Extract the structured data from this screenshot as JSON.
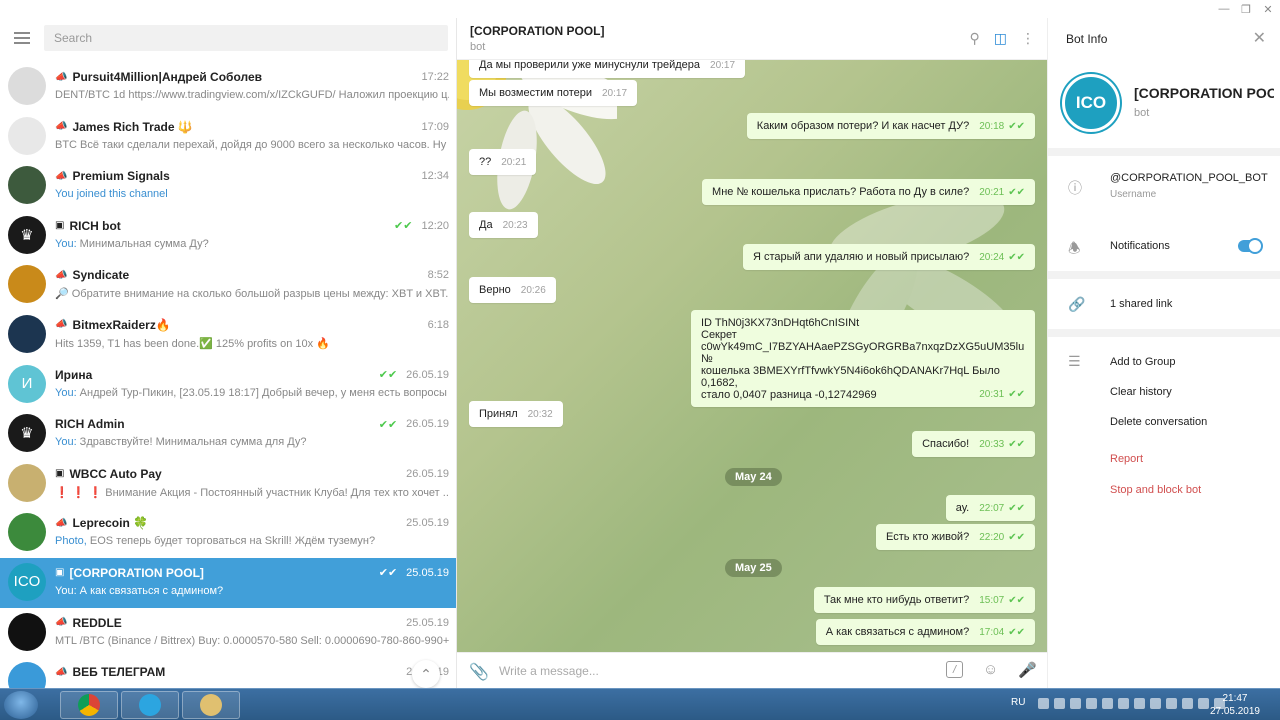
{
  "search": {
    "placeholder": "Search"
  },
  "chats": [
    {
      "name": "Pursuit4Million|Андрей Соболев",
      "type_icon": "megaphone-icon",
      "time": "17:22",
      "preview": "DENT/BTC 1d https://www.tradingview.com/x/IZCkGUFD/  Наложил проекцию ц...",
      "avatar_color": "#dcdcdc",
      "avatar_text": ""
    },
    {
      "name": "James Rich Trade 🔱",
      "type_icon": "megaphone-icon",
      "time": "17:09",
      "preview": "BTC Всё таки сделали перехай, дойдя до 9000 всего за несколько часов.  Ну и с...",
      "avatar_color": "#e8e8e8",
      "avatar_text": ""
    },
    {
      "name": "Premium Signals",
      "type_icon": "megaphone-icon",
      "time": "12:34",
      "you": "You joined this channel",
      "preview": "",
      "avatar_color": "#3d5a3d",
      "avatar_text": ""
    },
    {
      "name": "RICH bot",
      "type_icon": "bot-icon",
      "time": "12:20",
      "ticks": true,
      "you": "You:",
      "preview": " Минимальная сумма Ду?",
      "avatar_color": "#1a1a1a",
      "avatar_text": "♛"
    },
    {
      "name": "Syndicate",
      "type_icon": "megaphone-icon",
      "time": "8:52",
      "preview": "🔎 Обратите внимание на сколько большой разрыв цены между:  XBT и XBT...",
      "avatar_color": "#c98a1a",
      "avatar_text": ""
    },
    {
      "name": "BitmexRaiderz🔥",
      "type_icon": "megaphone-icon",
      "time": "6:18",
      "preview": "Hits 1359, T1 has been done.✅  125% profits on 10x 🔥",
      "avatar_color": "#1c3550",
      "avatar_text": ""
    },
    {
      "name": "Ирина",
      "type_icon": "",
      "time": "26.05.19",
      "ticks": true,
      "you": "You:",
      "preview": " Андрей Тур-Пикин, [23.05.19 18:17] Добрый вечер, у меня есть вопросы п...",
      "avatar_color": "#5fc4d4",
      "avatar_text": "И"
    },
    {
      "name": "RICH Admin",
      "type_icon": "",
      "time": "26.05.19",
      "ticks": true,
      "you": "You:",
      "preview": " Здравствуйте! Минимальная сумма для Ду?",
      "avatar_color": "#1a1a1a",
      "avatar_text": "♛"
    },
    {
      "name": "WBCC Auto Pay",
      "type_icon": "bot-icon",
      "time": "26.05.19",
      "preview": "❗ ❗ ❗  Внимание Акция - Постоянный участник Клуба!   Для тех кто хочет ...",
      "avatar_color": "#c8b070",
      "avatar_text": ""
    },
    {
      "name": "Leprecoin 🍀",
      "type_icon": "megaphone-icon",
      "time": "25.05.19",
      "you": "Photo,",
      "preview": " EOS теперь будет торговаться на Skrill! Ждём туземун?",
      "avatar_color": "#3c8a3c",
      "avatar_text": ""
    },
    {
      "name": "[CORPORATION POOL]",
      "type_icon": "bot-icon",
      "time": "25.05.19",
      "ticks": true,
      "you": "You:",
      "preview": " А как связаться с админом?",
      "avatar_color": "#1ea0c0",
      "avatar_text": "ICO",
      "active": true
    },
    {
      "name": "REDDLE",
      "type_icon": "megaphone-icon",
      "time": "25.05.19",
      "preview": "MTL /BTC (Binance / Bittrex)  Buy: 0.0000570-580  Sell: 0.0000690-780-860-990+",
      "avatar_color": "#111111",
      "avatar_text": ""
    },
    {
      "name": "ВЕБ ТЕЛЕГРАМ",
      "type_icon": "megaphone-icon",
      "time": "24.05.19",
      "preview": "",
      "avatar_color": "#3a9ad9",
      "avatar_text": ""
    }
  ],
  "header": {
    "title": "[CORPORATION POOL]",
    "subtitle": "bot"
  },
  "messages": [
    {
      "text": "Да мы проверили уже минуснули трейдера",
      "time": "20:17",
      "out": false
    },
    {
      "text": "Мы возместим потери",
      "time": "20:17",
      "out": false
    },
    {
      "text": "Каким образом потери? И как насчет ДУ?",
      "time": "20:18",
      "out": true
    },
    {
      "text": "??",
      "time": "20:21",
      "out": false
    },
    {
      "text": "Мне № кошелька прислать? Работа по Ду в силе?",
      "time": "20:21",
      "out": true
    },
    {
      "text": "Да",
      "time": "20:23",
      "out": false
    },
    {
      "text": "Я старый апи удаляю и новый присылаю?",
      "time": "20:24",
      "out": true
    },
    {
      "text": "Верно",
      "time": "20:26",
      "out": false
    },
    {
      "text": "ID  ThN0j3KX73nDHqt6hCnISINt\nСекрет\nc0wYk49mC_I7BZYAHAaePZSGyORGRBa7nxqzDzXG5uUM35lu  №\nкошелька 3BMEXYrfTfvwkY5N4i6ok6hQDANAKr7HqL  Было 0,1682,\nстало 0,0407 разница  -0,12742969",
      "time": "20:31",
      "out": true
    },
    {
      "text": "Принял",
      "time": "20:32",
      "out": false
    },
    {
      "text": "Спасибо!",
      "time": "20:33",
      "out": true
    },
    {
      "text": "ау.",
      "time": "22:07",
      "out": true
    },
    {
      "text": "Есть кто живой?",
      "time": "22:20",
      "out": true
    },
    {
      "text": "Так мне кто нибудь ответит?",
      "time": "15:07",
      "out": true
    },
    {
      "text": "А как связаться с админом?",
      "time": "17:04",
      "out": true
    }
  ],
  "dates": [
    "May 24",
    "May 25"
  ],
  "input": {
    "placeholder": "Write a message..."
  },
  "info": {
    "title": "Bot Info",
    "name": "[CORPORATION POOL]",
    "sub": "bot",
    "avatar_text": "ICO",
    "username": "@CORPORATION_POOL_BOT",
    "username_hint": "Username",
    "notifications": "Notifications",
    "shared": "1 shared link",
    "actions": [
      "Add to Group",
      "Clear history",
      "Delete conversation"
    ],
    "danger": [
      "Report",
      "Stop and block bot"
    ]
  },
  "taskbar": {
    "lang": "RU",
    "time": "21:47",
    "date": "27.05.2019"
  },
  "colors": {
    "accent": "#419fd9",
    "out_bubble": "#effdde",
    "check": "#5dc452",
    "danger": "#d14f4f"
  }
}
